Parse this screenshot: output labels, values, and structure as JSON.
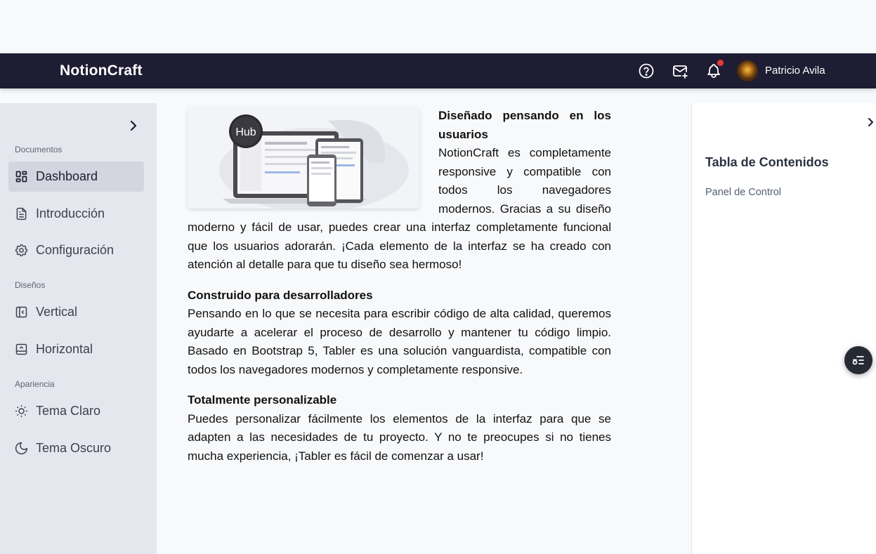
{
  "navbar": {
    "brand": "NotionCraft",
    "user_name": "Patricio Avila",
    "has_notification": true,
    "icons": [
      "help-icon",
      "mail-plus-icon",
      "bell-icon"
    ]
  },
  "sidebar": {
    "sections": [
      {
        "title": "Documentos",
        "items": [
          {
            "label": "Dashboard",
            "icon": "dashboard-icon",
            "active": true
          },
          {
            "label": "Introducción",
            "icon": "document-icon",
            "active": false
          },
          {
            "label": "Configuración",
            "icon": "gear-icon",
            "active": false
          }
        ]
      },
      {
        "title": "Diseños",
        "items": [
          {
            "label": "Vertical",
            "icon": "layout-sidebar-icon",
            "active": false
          },
          {
            "label": "Horizontal",
            "icon": "layout-navbar-icon",
            "active": false
          }
        ]
      },
      {
        "title": "Apariencia",
        "items": [
          {
            "label": "Tema Claro",
            "icon": "sun-icon",
            "active": false
          },
          {
            "label": "Tema Oscuro",
            "icon": "moon-icon",
            "active": false
          }
        ]
      }
    ]
  },
  "content": {
    "hero_badge": "Hub",
    "blocks": [
      {
        "title": "Diseñado pensando en los usuarios",
        "body": "NotionCraft es completamente responsive y compatible con todos los navegadores modernos. Gracias a su diseño moderno y fácil de usar, puedes crear una interfaz completamente funcional que los usuarios adorarán. ¡Cada elemento de la interfaz se ha creado con atención al detalle para que tu diseño sea hermoso!"
      },
      {
        "title": "Construido para desarrolladores",
        "body": "Pensando en lo que se necesita para escribir código de alta calidad, queremos ayudarte a acelerar el proceso de desarrollo y mantener tu código limpio. Basado en Bootstrap 5, Tabler es una solución vanguardista, compatible con todos los navegadores modernos y completamente responsive."
      },
      {
        "title": "Totalmente personalizable",
        "body": "Puedes personalizar fácilmente los elementos de la interfaz para que se adapten a las necesidades de tu proyecto. Y no te preocupes si no tienes mucha experiencia, ¡Tabler es fácil de comenzar a usar!"
      }
    ]
  },
  "toc": {
    "title": "Tabla de Contenidos",
    "items": [
      "Panel de Control"
    ]
  },
  "colors": {
    "navbar_bg": "#1e1d33",
    "sidebar_bg": "#e6e7ee",
    "active_item_bg": "#d3d6de",
    "notification_dot": "#e53935"
  }
}
